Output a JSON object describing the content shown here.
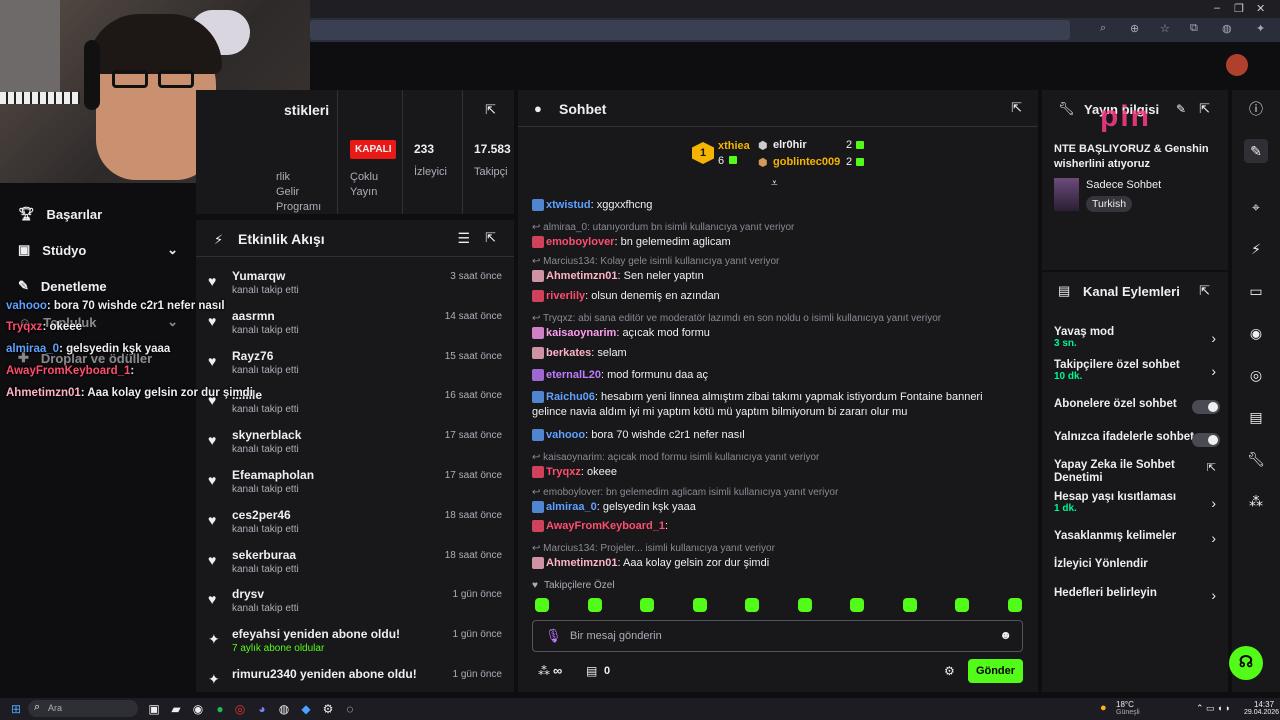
{
  "sidebar": {
    "items": [
      {
        "label": "Başarılar",
        "icon": "trophy-icon"
      },
      {
        "label": "Stüdyo",
        "icon": "studio-icon"
      },
      {
        "label": "Denetleme",
        "icon": "wrench-icon"
      },
      {
        "label": "Topluluk",
        "icon": "community-icon"
      },
      {
        "label": "Droplar ve ödüller",
        "icon": "drops-icon"
      }
    ]
  },
  "stats": {
    "title_partial": "stikleri",
    "col1": "rlik\nGelir\nProgramı",
    "status_badge": "KAPALI",
    "status_label": "Çoklu\nYayın",
    "viewers_value": "233",
    "viewers_label": "İzleyici",
    "followers_value": "17.583",
    "followers_label": "Takipçi"
  },
  "activity": {
    "title": "Etkinlik Akışı",
    "items": [
      {
        "name": "Yumarqw",
        "sub": "kanalı takip etti",
        "time": "3 saat önce",
        "kind": "follow"
      },
      {
        "name": "aasrmn",
        "sub": "kanalı takip etti",
        "time": "14 saat önce",
        "kind": "follow"
      },
      {
        "name": "Rayz76",
        "sub": "kanalı takip etti",
        "time": "15 saat önce",
        "kind": "follow"
      },
      {
        "name": "...lille",
        "sub": "kanalı takip etti",
        "time": "16 saat önce",
        "kind": "follow"
      },
      {
        "name": "skynerblack",
        "sub": "kanalı takip etti",
        "time": "17 saat önce",
        "kind": "follow"
      },
      {
        "name": "Efeamapholan",
        "sub": "kanalı takip etti",
        "time": "17 saat önce",
        "kind": "follow"
      },
      {
        "name": "ces2per46",
        "sub": "kanalı takip etti",
        "time": "18 saat önce",
        "kind": "follow"
      },
      {
        "name": "sekerburaa",
        "sub": "kanalı takip etti",
        "time": "18 saat önce",
        "kind": "follow"
      },
      {
        "name": "drysv",
        "sub": "kanalı takip etti",
        "time": "1 gün önce",
        "kind": "follow"
      },
      {
        "name": "efeyahsi yeniden abone oldu!",
        "sub": "7 aylık abone oldular",
        "time": "1 gün önce",
        "kind": "sub"
      },
      {
        "name": "rimuru2340 yeniden abone oldu!",
        "sub": "",
        "time": "1 gün önce",
        "kind": "sub"
      }
    ]
  },
  "chat": {
    "title": "Sohbet",
    "leaderboard": {
      "first": {
        "rank": "1",
        "name": "xthiea",
        "count": "6"
      },
      "second": {
        "name": "elr0hir",
        "count": "2"
      },
      "third": {
        "name": "goblintec009",
        "count": "2"
      }
    },
    "messages": [
      {
        "reply": "",
        "user": "xtwistud",
        "color": "#5ea1ff",
        "text": ": xggxxfhcng"
      },
      {
        "reply": "almiraa_0: utanıyordum bn isimli kullanıcıya yanıt veriyor",
        "user": "emoboylover",
        "color": "#ff4d6d",
        "text": ": bn gelemedim aglicam"
      },
      {
        "reply": "Marcius134: Kolay gele isimli kullanıcıya yanıt veriyor",
        "user": "Ahmetimzn01",
        "color": "#ffb3c7",
        "text": ": Sen neler yaptın"
      },
      {
        "reply": "",
        "user": "riverlily",
        "color": "#ff4d6d",
        "text": ": olsun denemiş en azından"
      },
      {
        "reply": "Tryqxz: abi sana editör ve moderatör lazımdı en son noldu o isimli kullanıcıya yanıt veriyor",
        "user": "kaisaoynarim",
        "color": "#ff9cf0",
        "text": ": açıcak mod formu"
      },
      {
        "reply": "",
        "user": "berkates",
        "color": "#ffb3c7",
        "text": ": selam"
      },
      {
        "reply": "",
        "user": "eternalL20",
        "color": "#bf7dff",
        "text": ": mod formunu daa aç"
      },
      {
        "reply": "",
        "user": "Raichu06",
        "color": "#5ea1ff",
        "text": ": hesabım yeni linnea almıştım zibai takımı yapmak istiyordum Fontaine banneri gelince navia aldım iyi mi yaptım kötü mü yaptım bilmiyorum bi zararı olur mu"
      },
      {
        "reply": "",
        "user": "vahooo",
        "color": "#5ea1ff",
        "text": ": bora 70 wishde c2r1 nefer nasıl"
      },
      {
        "reply": "kaisaoynarim: açıcak mod formu isimli kullanıcıya yanıt veriyor",
        "user": "Tryqxz",
        "color": "#ff4d6d",
        "text": ": okeee"
      },
      {
        "reply": "emoboylover: bn gelemedim aglicam isimli kullanıcıya yanıt veriyor",
        "user": "almiraa_0",
        "color": "#5ea1ff",
        "text": ": gelsyedin kşk yaaa"
      },
      {
        "reply": "",
        "user": "AwayFromKeyboard_1",
        "color": "#ff4d6d",
        "text": ":"
      },
      {
        "reply": "Marcius134: Projeler... isimli kullanıcıya yanıt veriyor",
        "user": "Ahmetimzn01",
        "color": "#ffb3c7",
        "text": ": Aaa kolay gelsin zor dur şimdi"
      }
    ],
    "followers_only": "Takipçilere Özel",
    "input_placeholder": "Bir mesaj gönderin",
    "points": "∞",
    "chests": "0",
    "send_label": "Gönder"
  },
  "stream_info": {
    "title": "Yayın bilgisi",
    "stream_title": "NTE BAŞLIYORUZ & Genshin wisherlini atıyoruz",
    "category": "Sadece Sohbet",
    "tag": "Turkish",
    "watermark": "pin"
  },
  "channel_actions": {
    "title": "Kanal Eylemleri",
    "items": [
      {
        "label": "Yavaş mod",
        "value": "3 sn.",
        "control": "chevron"
      },
      {
        "label": "Takipçilere özel sohbet",
        "value": "10 dk.",
        "control": "chevron"
      },
      {
        "label": "Abonelere özel sohbet",
        "value": "",
        "control": "toggle"
      },
      {
        "label": "Yalnızca ifadelerle sohbet",
        "value": "",
        "control": "toggle"
      },
      {
        "label": "Yapay Zeka ile Sohbet Denetimi",
        "value": "",
        "control": "external"
      },
      {
        "label": "Hesap yaşı kısıtlaması",
        "value": "1 dk.",
        "control": "chevron"
      },
      {
        "label": "Yasaklanmış kelimeler",
        "value": "",
        "control": "chevron"
      },
      {
        "label": "İzleyici Yönlendir",
        "value": "",
        "control": "none"
      },
      {
        "label": "Hedefleri belirleyin",
        "value": "",
        "control": "chevron"
      }
    ]
  },
  "overlay_chat": [
    {
      "user": "vahooo",
      "color": "#5ea1ff",
      "text": ": bora 70 wishde c2r1 nefer nasıl"
    },
    {
      "user": "Tryqxz",
      "color": "#ff4d6d",
      "text": ": okeee"
    },
    {
      "user": "almiraa_0",
      "color": "#5ea1ff",
      "text": ": gelsyedin kşk yaaa"
    },
    {
      "user": "AwayFromKeyboard_1",
      "color": "#ff4d6d",
      "text": ":"
    },
    {
      "user": "Ahmetimzn01",
      "color": "#ffb3c7",
      "text": ": Aaa kolay gelsin zor dur şimdi"
    }
  ],
  "taskbar": {
    "search_placeholder": "Ara",
    "weather_temp": "18°C",
    "weather_desc": "Güneşli",
    "time": "14:37",
    "date": "29.04.2026"
  },
  "colors": {
    "accent": "#53fc18",
    "panel": "#18181b",
    "bg": "#0e0e10"
  }
}
